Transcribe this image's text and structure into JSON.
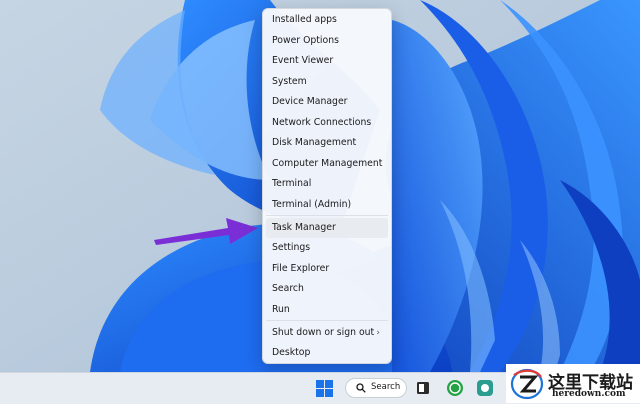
{
  "menu": {
    "items": [
      {
        "label": "Installed apps"
      },
      {
        "label": "Power Options"
      },
      {
        "label": "Event Viewer"
      },
      {
        "label": "System"
      },
      {
        "label": "Device Manager"
      },
      {
        "label": "Network Connections"
      },
      {
        "label": "Disk Management"
      },
      {
        "label": "Computer Management"
      },
      {
        "label": "Terminal"
      },
      {
        "label": "Terminal (Admin)"
      },
      {
        "label": "Task Manager",
        "highlighted": true
      },
      {
        "label": "Settings"
      },
      {
        "label": "File Explorer"
      },
      {
        "label": "Search"
      },
      {
        "label": "Run"
      },
      {
        "label": "Shut down or sign out",
        "submenu": true
      },
      {
        "label": "Desktop"
      }
    ]
  },
  "taskbar": {
    "search_label": "Search",
    "icons": [
      "windows-start-icon",
      "search-icon",
      "task-view-icon",
      "whatsapp-icon",
      "app-icon"
    ]
  },
  "watermark": {
    "title": "这里下载站",
    "domain": "heredown.com"
  },
  "colors": {
    "desktop_bg": "#b9ccde",
    "bloom_blue": "#1760e8",
    "arrow_purple": "#7a2fd6",
    "highlight": "#e8ebf0"
  }
}
